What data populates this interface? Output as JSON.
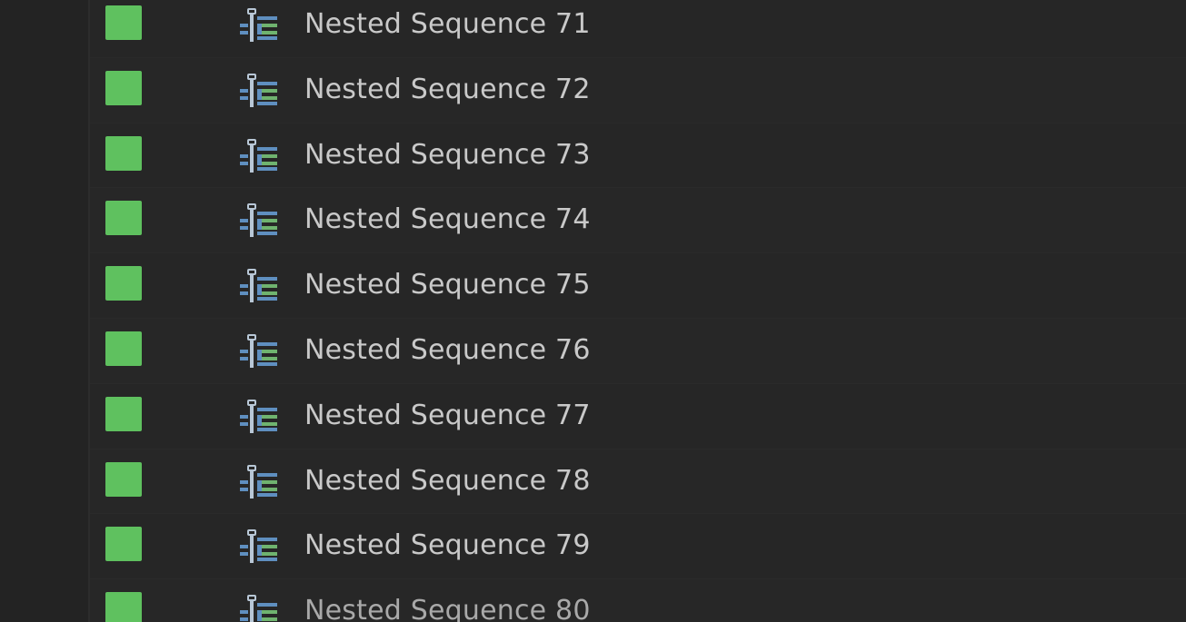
{
  "colors": {
    "label_color": "#5fc15f",
    "icon_blue": "#5f8fc0",
    "icon_light": "#b8c7d6",
    "icon_green": "#6fb36f",
    "text": "#c9c9c9"
  },
  "items": [
    {
      "name": "Nested Sequence 71",
      "icon": "nested-sequence-icon",
      "label_color": "green"
    },
    {
      "name": "Nested Sequence 72",
      "icon": "nested-sequence-icon",
      "label_color": "green"
    },
    {
      "name": "Nested Sequence 73",
      "icon": "nested-sequence-icon",
      "label_color": "green"
    },
    {
      "name": "Nested Sequence 74",
      "icon": "nested-sequence-icon",
      "label_color": "green"
    },
    {
      "name": "Nested Sequence 75",
      "icon": "nested-sequence-icon",
      "label_color": "green"
    },
    {
      "name": "Nested Sequence 76",
      "icon": "nested-sequence-icon",
      "label_color": "green"
    },
    {
      "name": "Nested Sequence 77",
      "icon": "nested-sequence-icon",
      "label_color": "green"
    },
    {
      "name": "Nested Sequence 78",
      "icon": "nested-sequence-icon",
      "label_color": "green"
    },
    {
      "name": "Nested Sequence 79",
      "icon": "nested-sequence-icon",
      "label_color": "green"
    },
    {
      "name": "Nested Sequence 80",
      "icon": "nested-sequence-icon",
      "label_color": "green"
    }
  ]
}
